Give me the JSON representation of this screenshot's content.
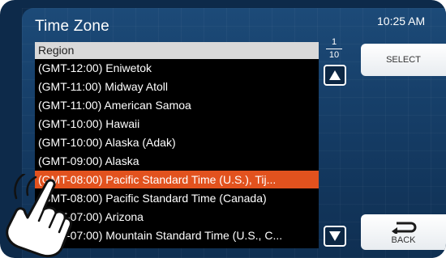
{
  "header": {
    "title": "Time Zone",
    "time": "10:25 AM"
  },
  "list": {
    "header": "Region",
    "items": [
      "(GMT-12:00) Eniwetok",
      "(GMT-11:00) Midway Atoll",
      "(GMT-11:00) American Samoa",
      "(GMT-10:00) Hawaii",
      "(GMT-10:00) Alaska (Adak)",
      "(GMT-09:00) Alaska",
      "(GMT-08:00) Pacific Standard Time (U.S.), Tij...",
      "(GMT-08:00) Pacific Standard Time (Canada)",
      "(GMT-07:00) Arizona",
      "(GMT-07:00) Mountain Standard Time (U.S., C..."
    ],
    "selected_index": 6
  },
  "pager": {
    "current": "1",
    "total": "10"
  },
  "buttons": {
    "select_label": "SELECT",
    "back_label": "BACK"
  },
  "colors": {
    "selection": "#e2521e",
    "background": "#143a62"
  },
  "icons": {
    "scroll_up": "triangle-up-icon",
    "scroll_down": "triangle-down-icon",
    "back": "return-arrow-icon",
    "hand": "pointing-hand-icon"
  }
}
